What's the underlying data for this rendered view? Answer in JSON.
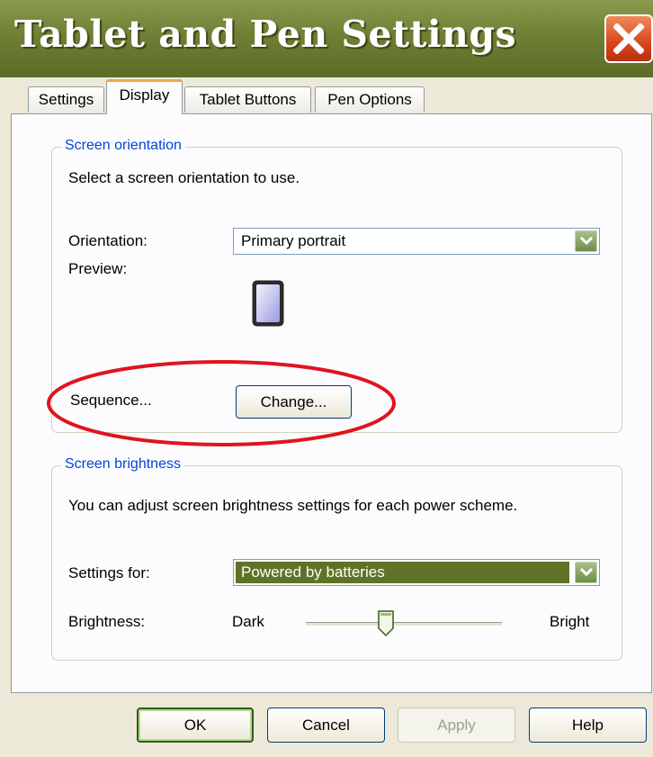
{
  "window": {
    "title": "Tablet and Pen Settings",
    "close_icon": "close-icon"
  },
  "tabs": [
    {
      "label": "Settings",
      "active": false
    },
    {
      "label": "Display",
      "active": true
    },
    {
      "label": "Tablet Buttons",
      "active": false
    },
    {
      "label": "Pen Options",
      "active": false
    }
  ],
  "orientation_group": {
    "legend": "Screen orientation",
    "description": "Select a screen orientation to use.",
    "orientation_label": "Orientation:",
    "orientation_value": "Primary portrait",
    "preview_label": "Preview:",
    "preview_icon": "portrait-screen-icon",
    "sequence_label": "Sequence...",
    "change_button": "Change..."
  },
  "brightness_group": {
    "legend": "Screen brightness",
    "description": "You can adjust screen brightness settings for each power scheme.",
    "settings_for_label": "Settings for:",
    "settings_for_value": "Powered by batteries",
    "brightness_label": "Brightness:",
    "dark_label": "Dark",
    "bright_label": "Bright",
    "brightness_level": 0.4
  },
  "footer": {
    "ok": "OK",
    "cancel": "Cancel",
    "apply": "Apply",
    "help": "Help"
  },
  "colors": {
    "highlight_circle": "#e0141e",
    "title_bar": "#6f7f34",
    "group_label": "#0046d5",
    "selected_item": "#5f7326"
  }
}
